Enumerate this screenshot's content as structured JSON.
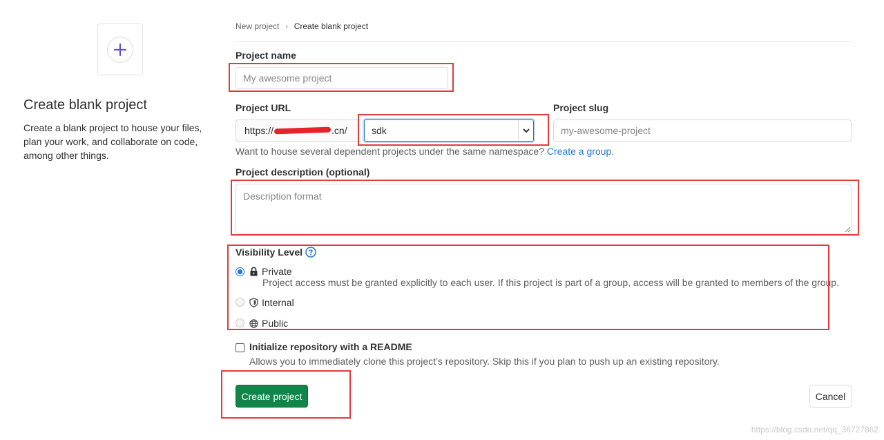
{
  "left_panel": {
    "title": "Create blank project",
    "description": "Create a blank project to house your files, plan your work, and collaborate on code, among other things.",
    "icon": "plus-icon"
  },
  "breadcrumb": {
    "parent": "New project",
    "current": "Create blank project"
  },
  "form": {
    "project_name": {
      "label": "Project name",
      "value": "",
      "placeholder": "My awesome project"
    },
    "project_url": {
      "label": "Project URL",
      "prefix_start": "https://",
      "prefix_end": ".cn/",
      "namespace_selected": "sdk"
    },
    "project_slug": {
      "label": "Project slug",
      "value": "",
      "placeholder": "my-awesome-project"
    },
    "namespace_help": {
      "text": "Want to house several dependent projects under the same namespace? ",
      "link": "Create a group."
    },
    "description": {
      "label": "Project description (optional)",
      "value": "",
      "placeholder": "Description format"
    },
    "visibility": {
      "label": "Visibility Level",
      "options": [
        {
          "label": "Private",
          "description": "Project access must be granted explicitly to each user. If this project is part of a group, access will be granted to members of the group.",
          "icon": "lock-icon",
          "checked": true
        },
        {
          "label": "Internal",
          "icon": "shield-icon",
          "checked": false
        },
        {
          "label": "Public",
          "icon": "globe-icon",
          "checked": false
        }
      ]
    },
    "readme": {
      "label": "Initialize repository with a README",
      "help": "Allows you to immediately clone this project’s repository. Skip this if you plan to push up an existing repository.",
      "checked": false
    }
  },
  "actions": {
    "create": "Create project",
    "cancel": "Cancel"
  },
  "watermark": "https://blog.csdn.net/qq_36727862",
  "colors": {
    "primary_button": "#108548",
    "link": "#1f78d1",
    "annotation": "#e5393a",
    "redaction": "#e8222a"
  }
}
